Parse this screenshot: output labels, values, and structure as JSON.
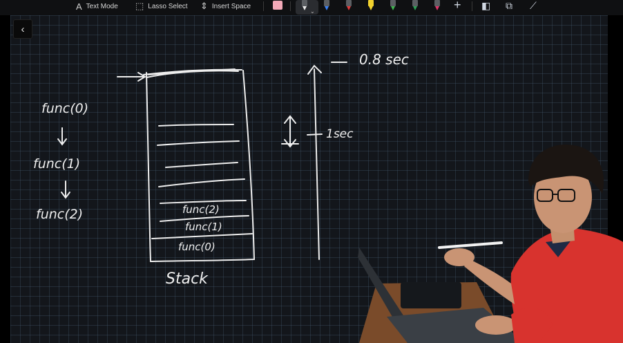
{
  "toolbar": {
    "text_mode_label": "Text Mode",
    "lasso_select_label": "Lasso Select",
    "insert_space_label": "Insert Space",
    "text_mode_icon": "text-mode-icon",
    "lasso_icon": "lasso-icon",
    "insert_space_icon": "insert-space-icon",
    "pens": [
      {
        "name": "pen-white",
        "color": "#e8e8e8"
      },
      {
        "name": "pen-blue",
        "color": "#3b82f6"
      },
      {
        "name": "pen-red",
        "color": "#e23a3a"
      },
      {
        "name": "pen-yellow",
        "color": "#f2d22e"
      },
      {
        "name": "pen-green",
        "color": "#3fb34f"
      },
      {
        "name": "pen-green-2",
        "color": "#2f9d55"
      },
      {
        "name": "pen-magenta",
        "color": "#e0356b"
      }
    ],
    "eraser_color": "#f2a9b8"
  },
  "canvas": {
    "notes": {
      "call_chain": [
        "func(0)",
        "func(1)",
        "func(2)"
      ],
      "stack_frames": [
        "func(2)",
        "func(1)",
        "func(0)"
      ],
      "stack_label": "Stack",
      "time_top": "0.8 sec",
      "time_mid": "1sec"
    }
  },
  "colors": {
    "canvas_bg": "#13161b",
    "ink": "#eeeeee",
    "shirt": "#d8332e"
  }
}
